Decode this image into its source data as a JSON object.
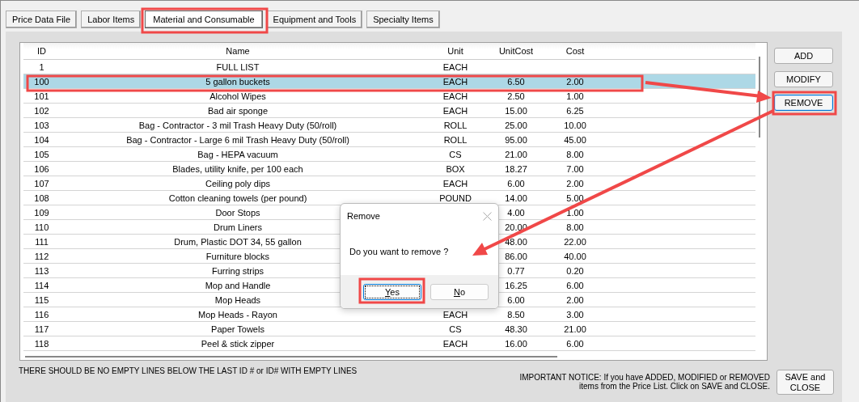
{
  "tabs": [
    {
      "label": "Price Data File",
      "selected": false
    },
    {
      "label": "Labor Items",
      "selected": false
    },
    {
      "label": "Material and Consumable",
      "selected": true
    },
    {
      "label": "Equipment and Tools",
      "selected": false
    },
    {
      "label": "Specialty Items",
      "selected": false
    }
  ],
  "table": {
    "columns": [
      "ID",
      "Name",
      "Unit",
      "UnitCost",
      "Cost"
    ],
    "rows": [
      {
        "id": "1",
        "name": "FULL LIST",
        "unit": "EACH",
        "unit_cost": "",
        "cost": "",
        "selected": false
      },
      {
        "id": "100",
        "name": "5 gallon buckets",
        "unit": "EACH",
        "unit_cost": "6.50",
        "cost": "2.00",
        "selected": true
      },
      {
        "id": "101",
        "name": "Alcohol Wipes",
        "unit": "EACH",
        "unit_cost": "2.50",
        "cost": "1.00",
        "selected": false
      },
      {
        "id": "102",
        "name": "Bad air sponge",
        "unit": "EACH",
        "unit_cost": "15.00",
        "cost": "6.25",
        "selected": false
      },
      {
        "id": "103",
        "name": "Bag - Contractor - 3 mil Trash Heavy Duty (50/roll)",
        "unit": "ROLL",
        "unit_cost": "25.00",
        "cost": "10.00",
        "selected": false
      },
      {
        "id": "104",
        "name": "Bag - Contractor - Large 6 mil Trash Heavy Duty (50/roll)",
        "unit": "ROLL",
        "unit_cost": "95.00",
        "cost": "45.00",
        "selected": false
      },
      {
        "id": "105",
        "name": "Bag - HEPA vacuum",
        "unit": "CS",
        "unit_cost": "21.00",
        "cost": "8.00",
        "selected": false
      },
      {
        "id": "106",
        "name": "Blades, utility knife, per 100 each",
        "unit": "BOX",
        "unit_cost": "18.27",
        "cost": "7.00",
        "selected": false
      },
      {
        "id": "107",
        "name": "Ceiling poly dips",
        "unit": "EACH",
        "unit_cost": "6.00",
        "cost": "2.00",
        "selected": false
      },
      {
        "id": "108",
        "name": "Cotton cleaning towels (per pound)",
        "unit": "POUND",
        "unit_cost": "14.00",
        "cost": "5.00",
        "selected": false
      },
      {
        "id": "109",
        "name": "Door Stops",
        "unit": "",
        "unit_cost": "4.00",
        "cost": "1.00",
        "selected": false
      },
      {
        "id": "110",
        "name": "Drum Liners",
        "unit": "",
        "unit_cost": "20.00",
        "cost": "8.00",
        "selected": false
      },
      {
        "id": "111",
        "name": "Drum, Plastic DOT 34, 55 gallon",
        "unit": "",
        "unit_cost": "48.00",
        "cost": "22.00",
        "selected": false
      },
      {
        "id": "112",
        "name": "Furniture blocks",
        "unit": "",
        "unit_cost": "86.00",
        "cost": "40.00",
        "selected": false
      },
      {
        "id": "113",
        "name": "Furring strips",
        "unit": "",
        "unit_cost": "0.77",
        "cost": "0.20",
        "selected": false
      },
      {
        "id": "114",
        "name": "Mop and Handle",
        "unit": "",
        "unit_cost": "16.25",
        "cost": "6.00",
        "selected": false
      },
      {
        "id": "115",
        "name": "Mop Heads",
        "unit": "",
        "unit_cost": "6.00",
        "cost": "2.00",
        "selected": false
      },
      {
        "id": "116",
        "name": "Mop Heads - Rayon",
        "unit": "EACH",
        "unit_cost": "8.50",
        "cost": "3.00",
        "selected": false
      },
      {
        "id": "117",
        "name": "Paper Towels",
        "unit": "CS",
        "unit_cost": "48.30",
        "cost": "21.00",
        "selected": false
      },
      {
        "id": "118",
        "name": "Peel & stick zipper",
        "unit": "EACH",
        "unit_cost": "16.00",
        "cost": "6.00",
        "selected": false
      }
    ]
  },
  "side_buttons": [
    {
      "label": "ADD",
      "focused": false
    },
    {
      "label": "MODIFY",
      "focused": false
    },
    {
      "label": "REMOVE",
      "focused": true
    }
  ],
  "empty_lines_note": "THERE SHOULD BE NO EMPTY LINES BELOW THE LAST ID # or ID# WITH EMPTY LINES",
  "notice": [
    "IMPORTANT NOTICE:  If you have ADDED, MODIFIED or REMOVED",
    "items from the Price List.  Click on SAVE and CLOSE."
  ],
  "save_button": "SAVE and CLOSE",
  "dialog": {
    "title": "Remove",
    "message": "Do you want to remove ?",
    "buttons": [
      {
        "label": "Yes",
        "focused": true
      },
      {
        "label": "No",
        "focused": false
      }
    ]
  }
}
